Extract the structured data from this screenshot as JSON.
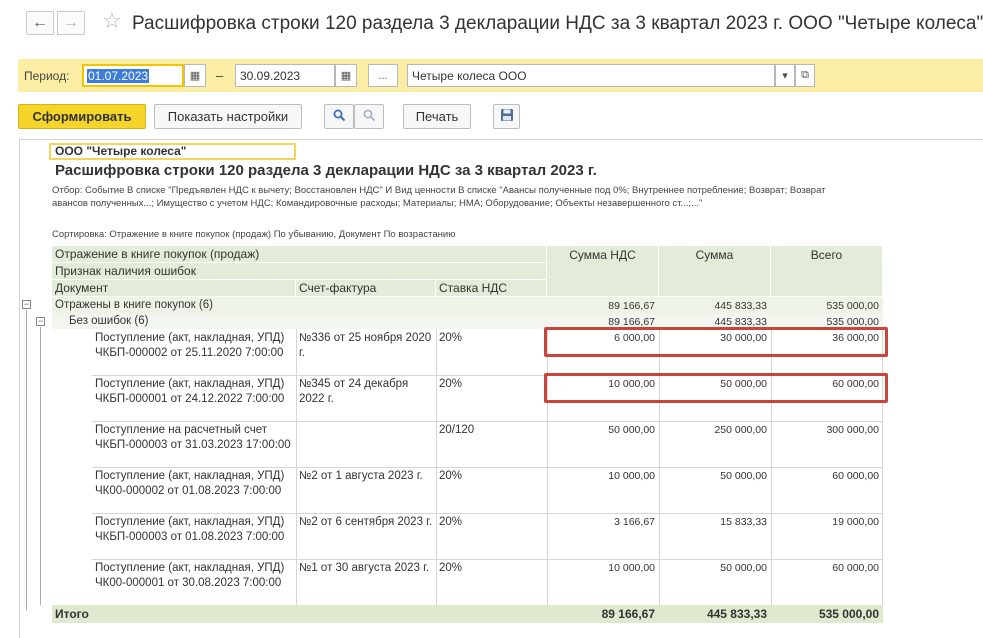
{
  "window": {
    "title": "Расшифровка строки 120 раздела 3 декларации НДС за 3 квартал 2023 г. ООО \"Четыре колеса\"",
    "back_icon": "←",
    "forward_icon": "→",
    "favorite_icon": "☆"
  },
  "period": {
    "label": "Период:",
    "from": "01.07.2023",
    "to": "30.09.2023",
    "dash": "–",
    "more_label": "...",
    "organization": "Четыре колеса ООО",
    "calendar_icon": "▦",
    "dropdown_icon": "▾",
    "open_icon": "⧉"
  },
  "toolbar": {
    "generate_label": "Сформировать",
    "settings_label": "Показать настройки",
    "search_icon": "🔍",
    "find_icon": "ℵ",
    "print_label": "Печать",
    "save_icon": "💾"
  },
  "report": {
    "organization": "ООО \"Четыре колеса\"",
    "title": "Расшифровка строки 120 раздела 3 декларации НДС за 3 квартал 2023 г.",
    "filter": "Отбор: Событие В списке \"Предъявлен НДС к вычету; Восстановлен НДС\" И Вид ценности В списке \"Авансы полученные под 0%; Внутреннее потребление; Возврат; Возврат авансов полученных...; Имущество с учетом НДС; Командировочные расходы; Материалы; НМА; Оборудование; Объекты незавершенного ст...;...\"",
    "sort": "Сортировка: Отражение в книге покупок (продаж) По убыванию, Документ По возрастанию"
  },
  "table": {
    "headers": {
      "reflection": "Отражение в книге покупок (продаж)",
      "errors": "Признак наличия ошибок",
      "document": "Документ",
      "invoice": "Счет-фактура",
      "rate": "Ставка НДС",
      "vat": "Сумма НДС",
      "amount": "Сумма",
      "total": "Всего"
    },
    "group1": {
      "label": "Отражены в книге покупок (6)",
      "vat": "89 166,67",
      "amount": "445 833,33",
      "total": "535 000,00"
    },
    "group2": {
      "label": "Без ошибок (6)",
      "vat": "89 166,67",
      "amount": "445 833,33",
      "total": "535 000,00"
    },
    "rows": [
      {
        "doc": "Поступление (акт, накладная, УПД) ЧКБП-000002 от 25.11.2020 7:00:00",
        "invoice": "№336 от 25 ноября 2020 г.",
        "rate": "20%",
        "vat": "6 000,00",
        "amount": "30 000,00",
        "total": "36 000,00"
      },
      {
        "doc": "Поступление (акт, накладная, УПД) ЧКБП-000001 от 24.12.2022 7:00:00",
        "invoice": "№345 от 24 декабря 2022 г.",
        "rate": "20%",
        "vat": "10 000,00",
        "amount": "50 000,00",
        "total": "60 000,00"
      },
      {
        "doc": "Поступление на расчетный счет ЧКБП-000003 от 31.03.2023 17:00:00",
        "invoice": "",
        "rate": "20/120",
        "vat": "50 000,00",
        "amount": "250 000,00",
        "total": "300 000,00"
      },
      {
        "doc": "Поступление (акт, накладная, УПД) ЧК00-000002 от 01.08.2023 7:00:00",
        "invoice": "№2 от 1 августа 2023 г.",
        "rate": "20%",
        "vat": "10 000,00",
        "amount": "50 000,00",
        "total": "60 000,00"
      },
      {
        "doc": "Поступление (акт, накладная, УПД) ЧКБП-000003 от 01.08.2023 7:00:00",
        "invoice": "№2 от 6 сентября 2023 г.",
        "rate": "20%",
        "vat": "3 166,67",
        "amount": "15 833,33",
        "total": "19 000,00"
      },
      {
        "doc": "Поступление (акт, накладная, УПД) ЧК00-000001 от 30.08.2023 7:00:00",
        "invoice": "№1 от 30 августа 2023 г.",
        "rate": "20%",
        "vat": "10 000,00",
        "amount": "50 000,00",
        "total": "60 000,00"
      }
    ],
    "footer": {
      "label": "Итого",
      "vat": "89 166,67",
      "amount": "445 833,33",
      "total": "535 000,00"
    },
    "collapse_icon": "−"
  },
  "colors": {
    "accent_yellow": "#f6d52a",
    "period_band": "#fbeda3",
    "header_green": "#e3ecd8",
    "highlight_red": "#c9453b"
  }
}
